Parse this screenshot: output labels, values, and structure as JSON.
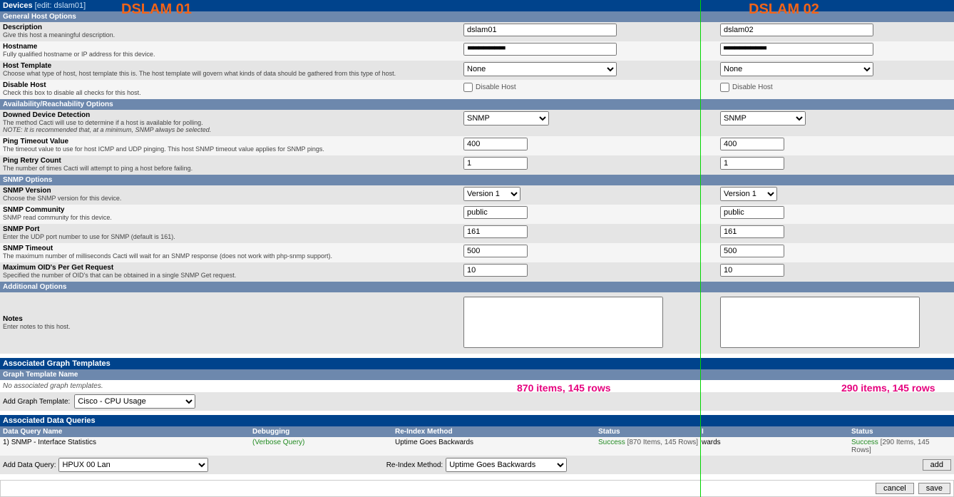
{
  "annotations": {
    "left_label": "DSLAM 01",
    "right_label": "DSLAM 02",
    "pink_left": "870 items, 145 rows",
    "pink_right": "290 items, 145 rows"
  },
  "header": {
    "title": "Devices",
    "edit_suffix": "[edit: dslam01]"
  },
  "sections": {
    "general": "General Host Options",
    "availability": "Availability/Reachability Options",
    "snmp": "SNMP Options",
    "additional": "Additional Options"
  },
  "fields": {
    "description": {
      "title": "Description",
      "sub": "Give this host a meaningful description.",
      "v1": "dslam01",
      "v2": "dslam02"
    },
    "hostname": {
      "title": "Hostname",
      "sub": "Fully qualified hostname or IP address for this device.",
      "v1": "",
      "v2": ""
    },
    "hosttpl": {
      "title": "Host Template",
      "sub": "Choose what type of host, host template this is. The host template will govern what kinds of data should be gathered from this type of host.",
      "v1": "None",
      "v2": "None"
    },
    "disable": {
      "title": "Disable Host",
      "sub": "Check this box to disable all checks for this host.",
      "lbl": "Disable Host"
    },
    "downed": {
      "title": "Downed Device Detection",
      "sub": "The method Cacti will use to determine if a host is available for polling.",
      "note": "NOTE: It is recommended that, at a minimum, SNMP always be selected.",
      "v1": "SNMP",
      "v2": "SNMP"
    },
    "pingtimeout": {
      "title": "Ping Timeout Value",
      "sub": "The timeout value to use for host ICMP and UDP pinging. This host SNMP timeout value applies for SNMP pings.",
      "v1": "400",
      "v2": "400"
    },
    "pingretry": {
      "title": "Ping Retry Count",
      "sub": "The number of times Cacti will attempt to ping a host before failing.",
      "v1": "1",
      "v2": "1"
    },
    "snmpver": {
      "title": "SNMP Version",
      "sub": "Choose the SNMP version for this device.",
      "v1": "Version 1",
      "v2": "Version 1"
    },
    "snmpcomm": {
      "title": "SNMP Community",
      "sub": "SNMP read community for this device.",
      "v1": "public",
      "v2": "public"
    },
    "snmpport": {
      "title": "SNMP Port",
      "sub": "Enter the UDP port number to use for SNMP (default is 161).",
      "v1": "161",
      "v2": "161"
    },
    "snmptimeout": {
      "title": "SNMP Timeout",
      "sub": "The maximum number of milliseconds Cacti will wait for an SNMP response (does not work with php-snmp support).",
      "v1": "500",
      "v2": "500"
    },
    "maxoid": {
      "title": "Maximum OID's Per Get Request",
      "sub": "Specified the number of OID's that can be obtained in a single SNMP Get request.",
      "v1": "10",
      "v2": "10"
    },
    "notes": {
      "title": "Notes",
      "sub": "Enter notes to this host."
    }
  },
  "graph_templates": {
    "header": "Associated Graph Templates",
    "col": "Graph Template Name",
    "none": "No associated graph templates.",
    "add_label": "Add Graph Template:",
    "add_select": "Cisco - CPU Usage"
  },
  "data_queries": {
    "header": "Associated Data Queries",
    "cols": {
      "name": "Data Query Name",
      "debug": "Debugging",
      "reindex": "Re-Index Method",
      "status": "Status",
      "status2": "Status"
    },
    "row": {
      "idx": "1)",
      "name": "SNMP - Interface Statistics",
      "debug": "(Verbose Query)",
      "reindex": "Uptime Goes Backwards",
      "status_l": "Success",
      "status_l_suffix": "[870 Items, 145 Rows]",
      "mid": "wards",
      "status_r": "Success",
      "status_r_suffix": "[290 Items, 145 Rows]"
    },
    "add_label": "Add Data Query:",
    "add_select": "HPUX 00 Lan",
    "reindex_label": "Re-Index Method:",
    "reindex_select": "Uptime Goes Backwards",
    "add_btn": "add"
  },
  "buttons": {
    "cancel": "cancel",
    "save": "save"
  }
}
